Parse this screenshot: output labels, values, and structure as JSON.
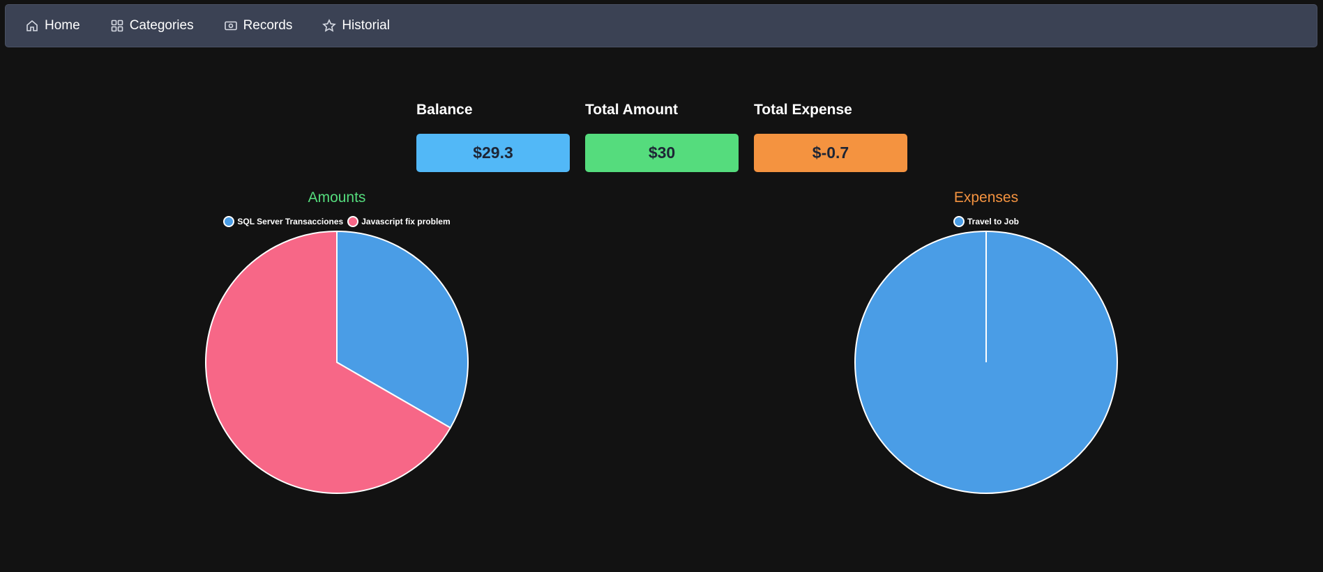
{
  "nav": {
    "items": [
      {
        "label": "Home",
        "icon": "home-icon"
      },
      {
        "label": "Categories",
        "icon": "grid-icon"
      },
      {
        "label": "Records",
        "icon": "money-icon"
      },
      {
        "label": "Historial",
        "icon": "star-icon"
      }
    ]
  },
  "summary": {
    "balance": {
      "label": "Balance",
      "value": "$29.3",
      "color": "#52b8f7"
    },
    "total_amount": {
      "label": "Total Amount",
      "value": "$30",
      "color": "#55dc7d"
    },
    "total_expense": {
      "label": "Total Expense",
      "value": "$-0.7",
      "color": "#f49340"
    }
  },
  "colors": {
    "amounts_title": "#55dc7d",
    "expenses_title": "#f49340"
  },
  "chart_data": [
    {
      "type": "pie",
      "title": "Amounts",
      "categories": [
        "SQL Server Transacciones",
        "Javascript fix problem"
      ],
      "values": [
        1,
        2
      ],
      "colors": [
        "#4a9de6",
        "#f76787"
      ],
      "legend": "top"
    },
    {
      "type": "pie",
      "title": "Expenses",
      "categories": [
        "Travel to Job"
      ],
      "values": [
        1
      ],
      "colors": [
        "#4a9de6"
      ],
      "legend": "top"
    }
  ]
}
